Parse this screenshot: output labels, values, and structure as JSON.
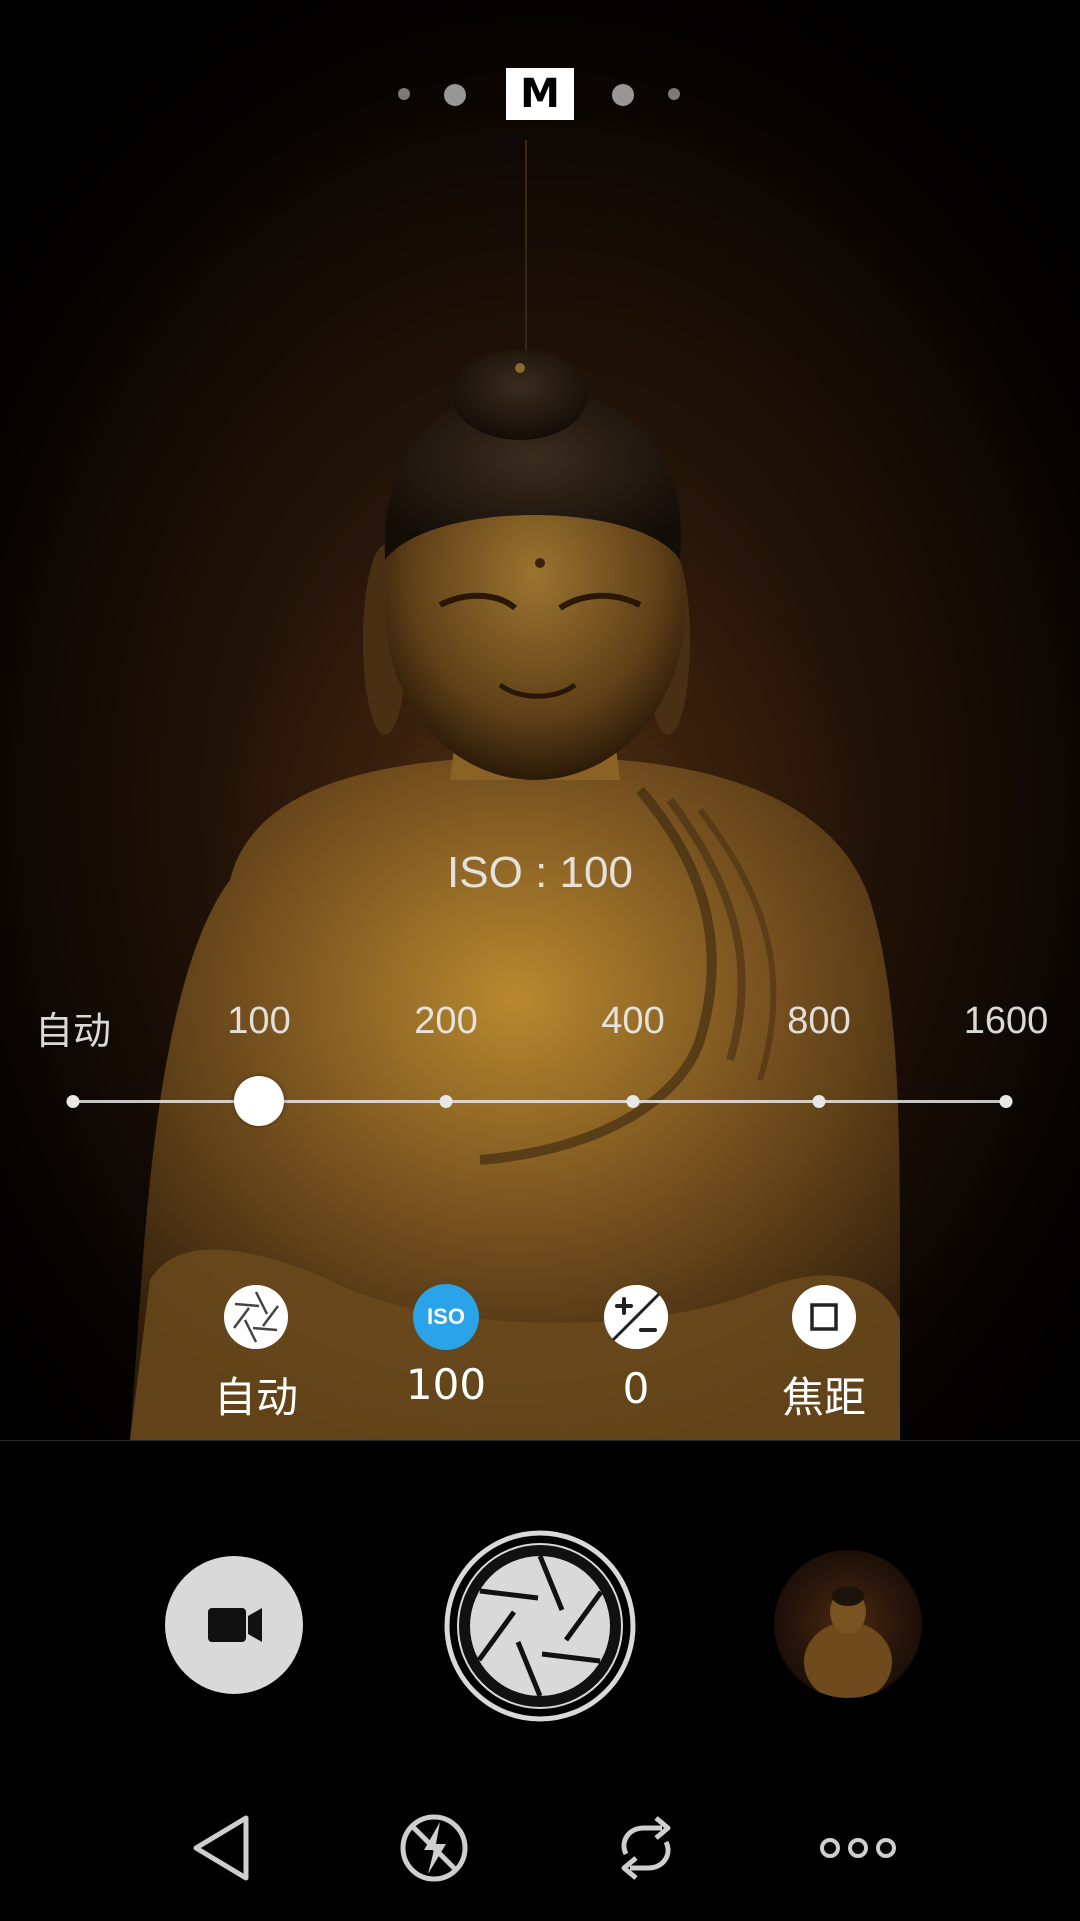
{
  "mode_indicator": {
    "current_mode": "M"
  },
  "iso_readout": "ISO : 100",
  "iso_slider": {
    "labels": [
      "自动",
      "100",
      "200",
      "400",
      "800",
      "1600"
    ],
    "selected_index": 1
  },
  "params": {
    "shutter": {
      "icon": "aperture-icon",
      "value": "自动"
    },
    "iso": {
      "icon": "iso-icon",
      "icon_text": "ISO",
      "value": "100",
      "accent": "#2aa3e8"
    },
    "exposure": {
      "icon": "exposure-compensation-icon",
      "value": "0"
    },
    "focus": {
      "icon": "focus-square-icon",
      "value": "焦距"
    }
  },
  "controls": {
    "video_icon": "video-camera-icon",
    "shutter_icon": "shutter-icon",
    "gallery_icon": "gallery-thumbnail"
  },
  "nav": {
    "back_icon": "back-triangle-icon",
    "flash_icon": "flash-off-icon",
    "switch_icon": "switch-camera-icon",
    "more_icon": "more-dots-icon"
  }
}
